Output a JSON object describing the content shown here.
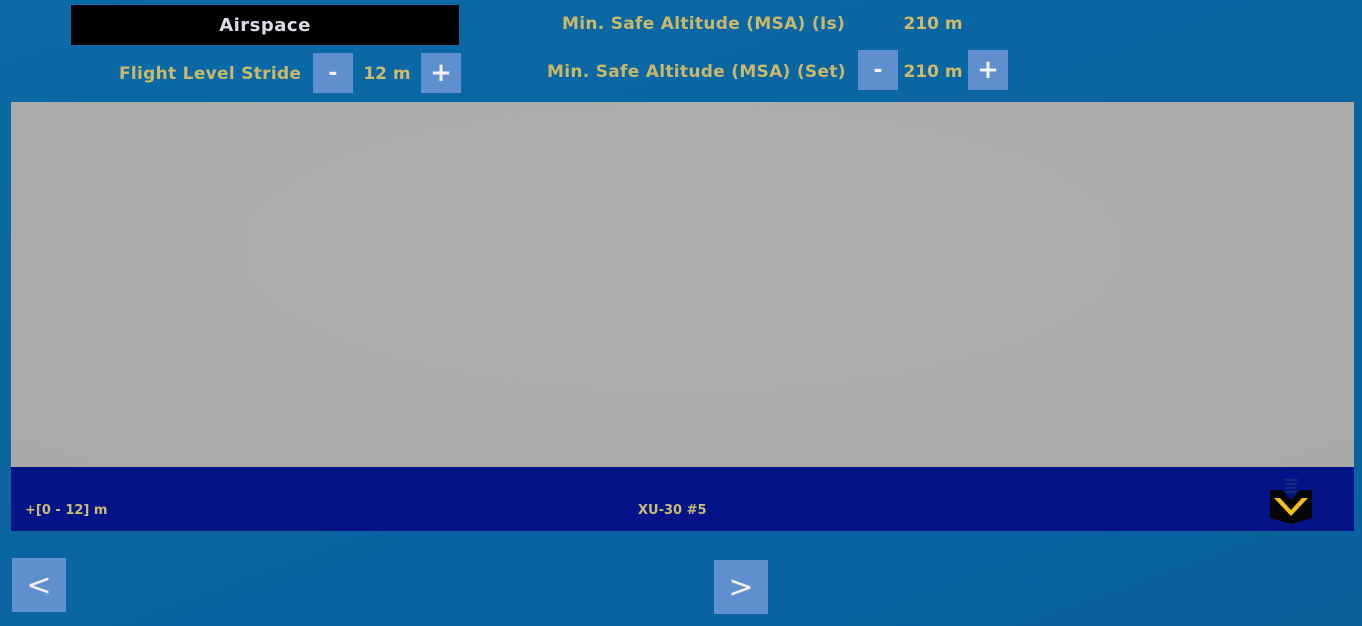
{
  "header": {
    "title": "Airspace"
  },
  "flight_level_stride": {
    "label": "Flight Level Stride",
    "value": "12 m",
    "decrement_label": "-",
    "increment_label": "+"
  },
  "msa_is": {
    "label": "Min. Safe Altitude (MSA) (Is)",
    "value": "210 m"
  },
  "msa_set": {
    "label": "Min. Safe Altitude (MSA) (Set)",
    "value": "210 m",
    "decrement_label": "-",
    "increment_label": "+"
  },
  "footer": {
    "range_text": "+[0 - 12] m",
    "vehicle_text": "XU-30 #5",
    "icon": "drop-in-tray-icon"
  },
  "navigation": {
    "prev_label": "<",
    "next_label": ">"
  },
  "colors": {
    "background": "#0a66a3",
    "panel": "#ababa9",
    "footer_bar": "#041488",
    "button": "#5f8fcf",
    "label_text": "#c8b86a",
    "icon_accent": "#f2c21a"
  }
}
